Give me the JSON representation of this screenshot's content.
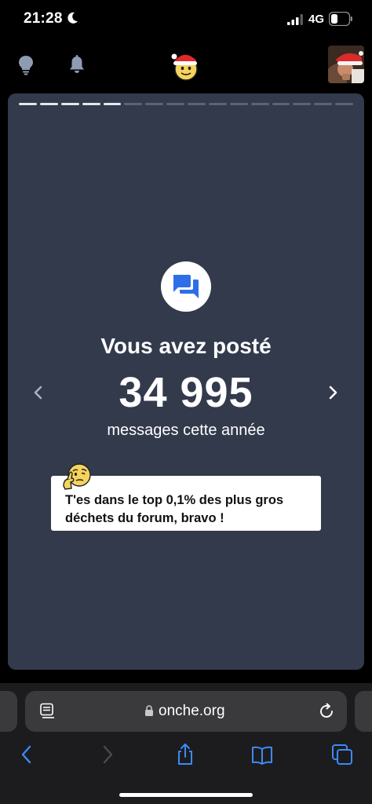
{
  "status_bar": {
    "time": "21:28",
    "network": "4G",
    "icons": [
      "moon-icon",
      "signal-icon",
      "battery-icon"
    ]
  },
  "header": {
    "icons": [
      "lightbulb-icon",
      "bell-icon",
      "santa-emoji-logo",
      "profile-avatar"
    ]
  },
  "story": {
    "total_segments": 16,
    "completed_segments": 5,
    "icon": "chat-bubbles-icon",
    "headline": "Vous avez posté",
    "number": "34 995",
    "subline": "messages cette année",
    "comment": "T'es dans le top 0,1% des plus gros déchets du forum, bravo !",
    "comment_emoji": "thinking-emoji"
  },
  "browser": {
    "url": "onche.org",
    "icons": [
      "reader-icon",
      "lock-icon",
      "reload-icon",
      "back-icon",
      "forward-icon",
      "share-icon",
      "bookmarks-icon",
      "tabs-icon"
    ]
  },
  "colors": {
    "card_bg": "#323a4c",
    "accent_blue": "#2e6fe8",
    "safari_blue": "#3d8af7"
  }
}
